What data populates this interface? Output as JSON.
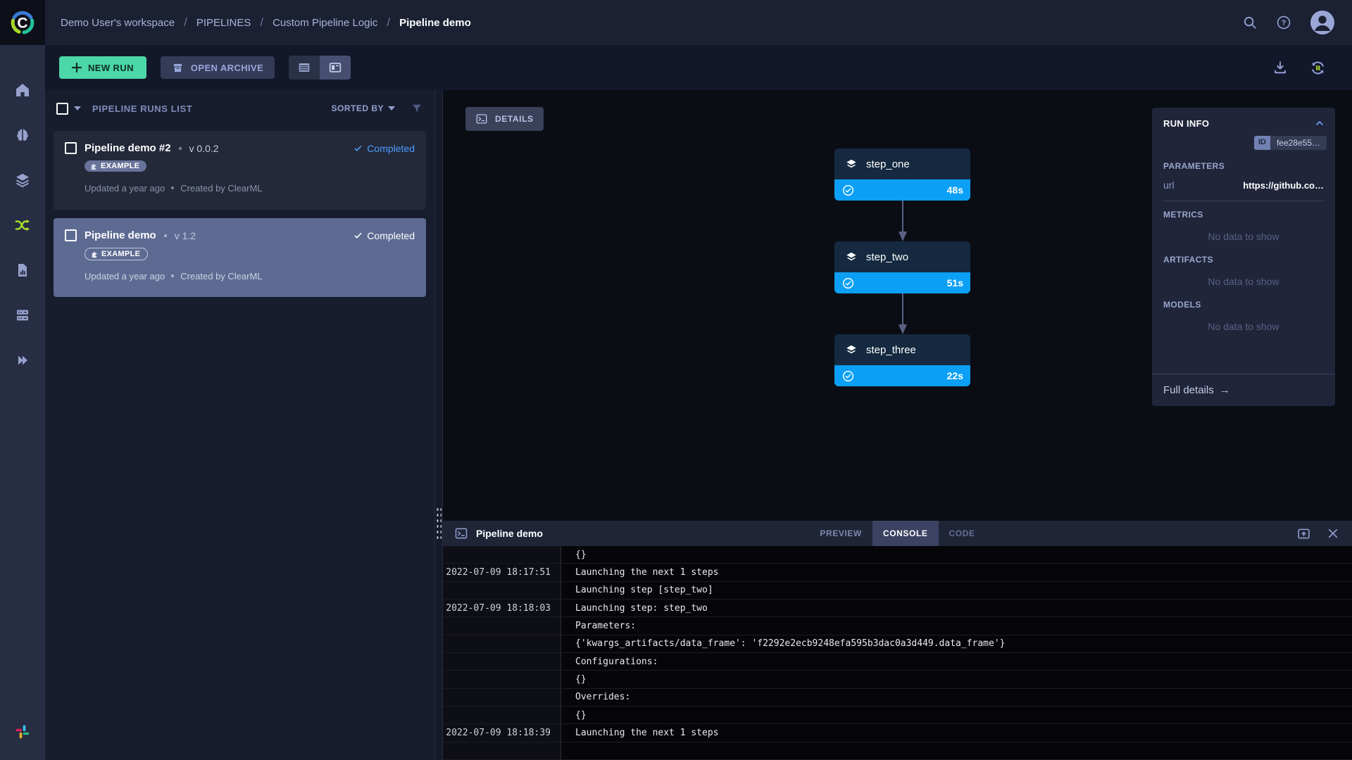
{
  "header": {
    "breadcrumbs": [
      "Demo User's workspace",
      "PIPELINES",
      "Custom Pipeline Logic",
      "Pipeline demo"
    ]
  },
  "sidebar": {
    "items": [
      "dashboard",
      "projects",
      "datasets",
      "pipelines",
      "reports",
      "workers-queues",
      "applications",
      "slack"
    ],
    "active": "pipelines"
  },
  "toolbar": {
    "new_run_label": "NEW RUN",
    "open_archive_label": "OPEN ARCHIVE"
  },
  "runs_list": {
    "title": "PIPELINE RUNS LIST",
    "sorted_by_label": "SORTED BY",
    "cards": [
      {
        "name": "Pipeline demo #2",
        "version": "v 0.0.2",
        "status": "Completed",
        "tag": "EXAMPLE",
        "updated": "Updated a year ago",
        "created": "Created by ClearML"
      },
      {
        "name": "Pipeline demo",
        "version": "v 1.2",
        "status": "Completed",
        "tag": "EXAMPLE",
        "updated": "Updated a year ago",
        "created": "Created by ClearML"
      }
    ]
  },
  "graph": {
    "details_label": "DETAILS",
    "nodes": [
      {
        "name": "step_one",
        "duration": "48s"
      },
      {
        "name": "step_two",
        "duration": "51s"
      },
      {
        "name": "step_three",
        "duration": "22s"
      }
    ]
  },
  "run_info": {
    "title": "RUN INFO",
    "id_label": "ID",
    "id_value": "fee28e55…",
    "parameters_title": "PARAMETERS",
    "param_label": "url",
    "param_value": "https://github.co…",
    "metrics_title": "METRICS",
    "artifacts_title": "ARTIFACTS",
    "models_title": "MODELS",
    "no_data": "No data to show",
    "full_details_label": "Full details",
    "full_details_arrow": "→"
  },
  "console": {
    "title": "Pipeline demo",
    "tabs": [
      {
        "label": "PREVIEW"
      },
      {
        "label": "CONSOLE"
      },
      {
        "label": "CODE"
      }
    ],
    "rows": [
      {
        "ts": "",
        "text": "{}"
      },
      {
        "ts": "2022-07-09 18:17:51",
        "text": "Launching the next 1 steps"
      },
      {
        "ts": "",
        "text": "Launching step [step_two]"
      },
      {
        "ts": "2022-07-09 18:18:03",
        "text": "Launching step: step_two"
      },
      {
        "ts": "",
        "text": "Parameters:"
      },
      {
        "ts": "",
        "text": "{'kwargs_artifacts/data_frame': 'f2292e2ecb9248efa595b3dac0a3d449.data_frame'}"
      },
      {
        "ts": "",
        "text": "Configurations:"
      },
      {
        "ts": "",
        "text": "{}"
      },
      {
        "ts": "",
        "text": "Overrides:"
      },
      {
        "ts": "",
        "text": "{}"
      },
      {
        "ts": "2022-07-09 18:18:39",
        "text": "Launching the next 1 steps"
      },
      {
        "ts": "",
        "text": ""
      }
    ]
  },
  "colors": {
    "accent_green": "#4bd7a7",
    "node_blue": "#0ba0f5",
    "status_blue": "#4d9bff",
    "active_lime": "#a9e22e",
    "selected_card": "#5d6b92"
  }
}
